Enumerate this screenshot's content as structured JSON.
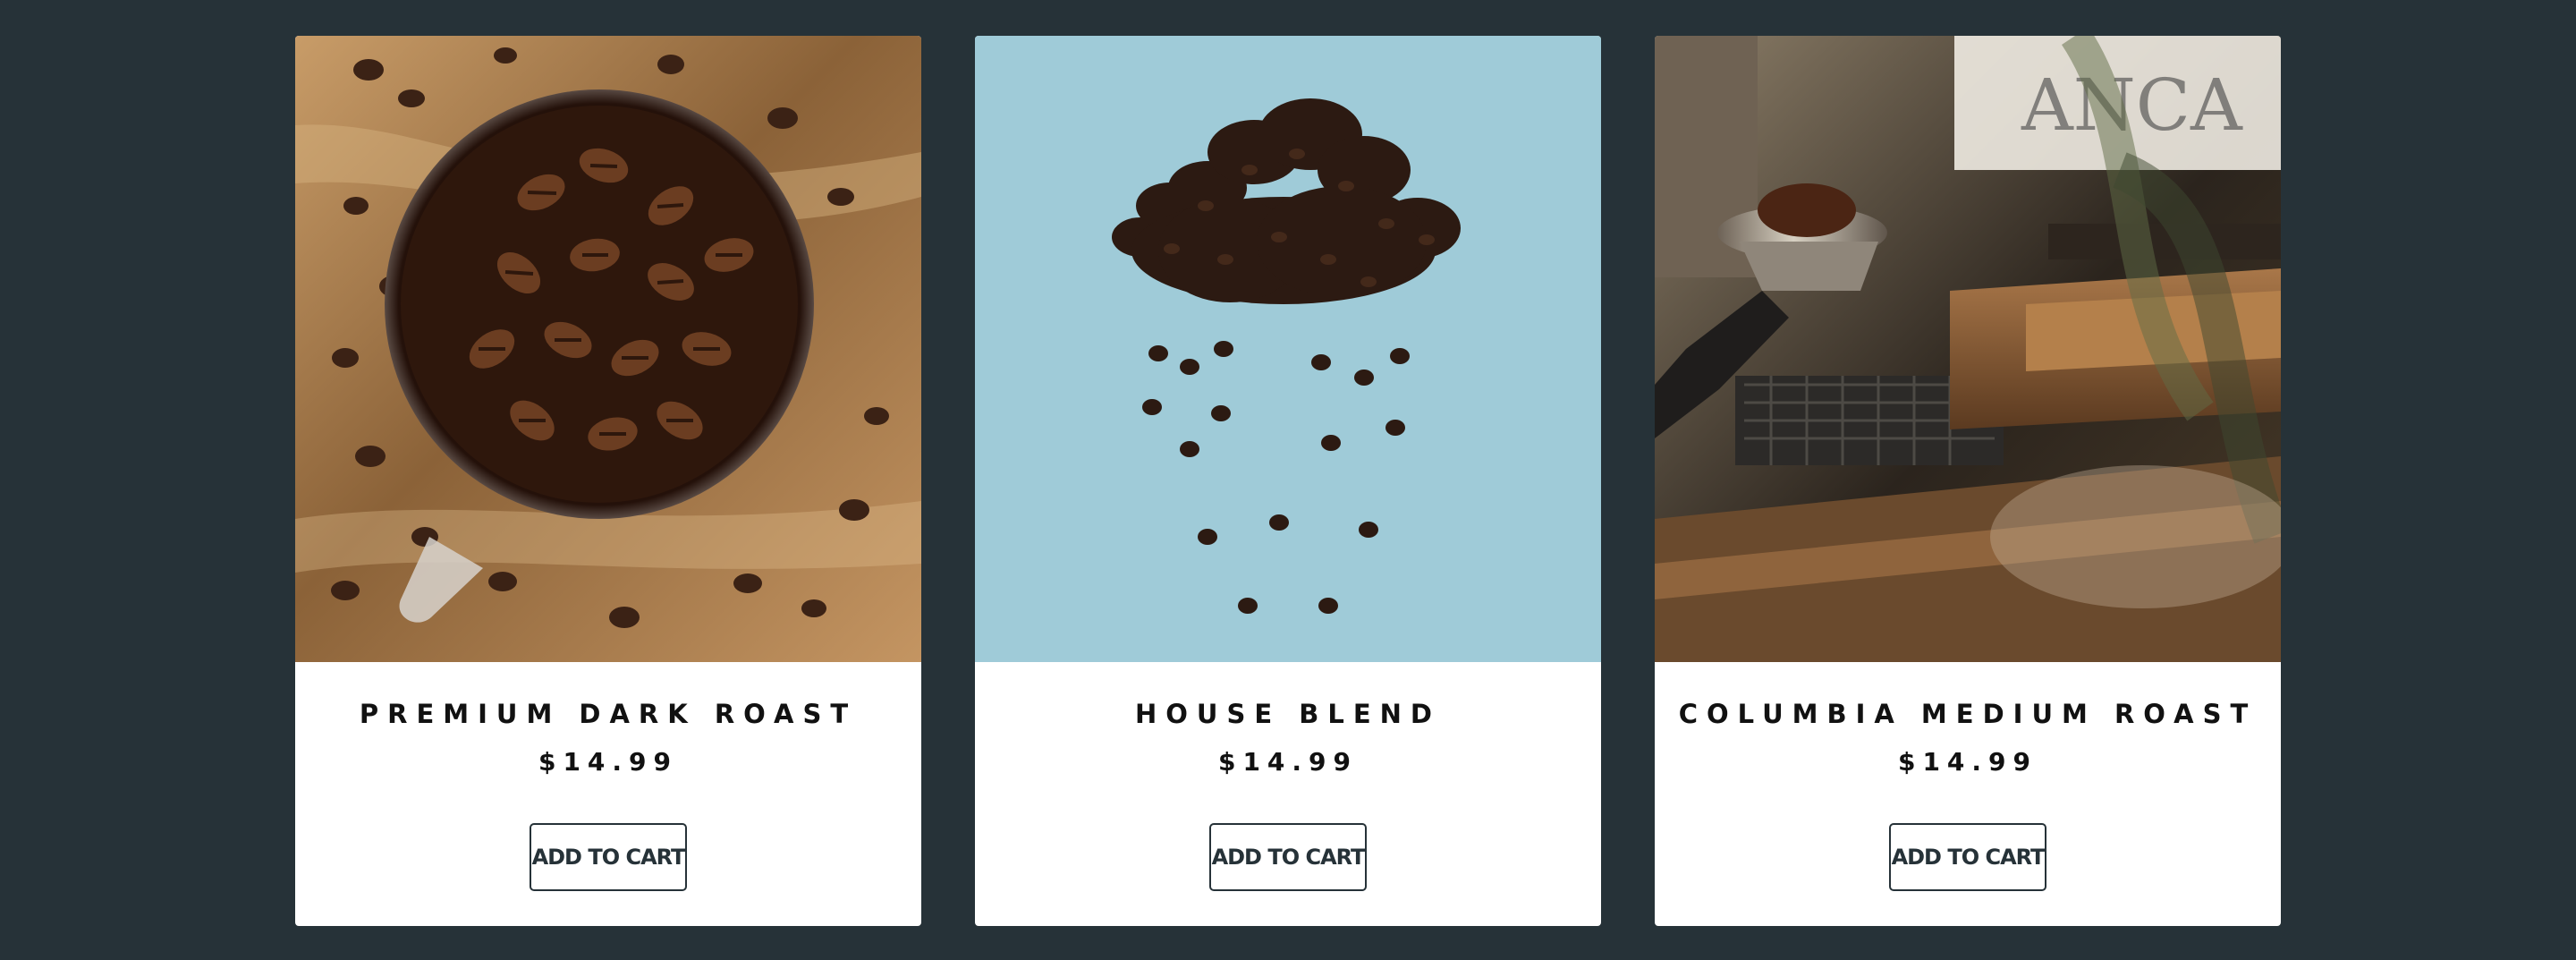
{
  "products": [
    {
      "name": "PREMIUM DARK ROAST",
      "price": "$14.99",
      "button": "ADD TO CART",
      "image_subject": "coffee-beans-cup"
    },
    {
      "name": "HOUSE BLEND",
      "price": "$14.99",
      "button": "ADD TO CART",
      "image_subject": "coffee-bean-cloud"
    },
    {
      "name": "COLUMBIA MEDIUM ROAST",
      "price": "$14.99",
      "button": "ADD TO CART",
      "image_subject": "espresso-machine"
    }
  ],
  "colors": {
    "page_background": "#263238",
    "card_background": "#ffffff",
    "button_border": "#263238",
    "text": "#111111"
  }
}
